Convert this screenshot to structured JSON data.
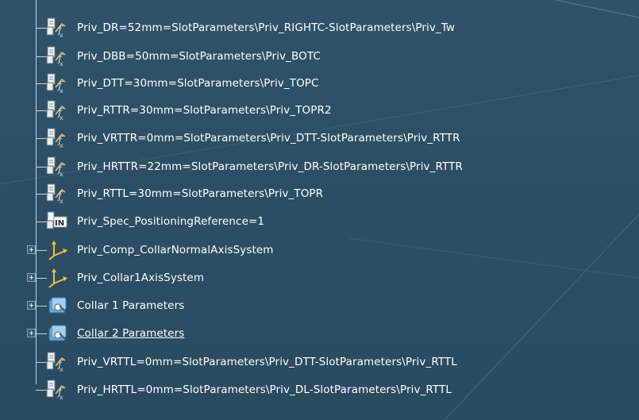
{
  "tree": {
    "items": [
      {
        "label": "Priv_DR=52mm=SlotParameters\\Priv_RIGHTC-SlotParameters\\Priv_Tw",
        "icon": "formula-icon",
        "expandable": false
      },
      {
        "label": "Priv_DBB=50mm=SlotParameters\\Priv_BOTC",
        "icon": "formula-icon",
        "expandable": false
      },
      {
        "label": "Priv_DTT=30mm=SlotParameters\\Priv_TOPC",
        "icon": "formula-icon",
        "expandable": false
      },
      {
        "label": "Priv_RTTR=30mm=SlotParameters\\Priv_TOPR2",
        "icon": "formula-icon",
        "expandable": false
      },
      {
        "label": "Priv_VRTTR=0mm=SlotParameters\\Priv_DTT-SlotParameters\\Priv_RTTR",
        "icon": "formula-icon",
        "expandable": false
      },
      {
        "label": "Priv_HRTTR=22mm=SlotParameters\\Priv_DR-SlotParameters\\Priv_RTTR",
        "icon": "formula-icon",
        "expandable": false
      },
      {
        "label": "Priv_RTTL=30mm=SlotParameters\\Priv_TOPR",
        "icon": "formula-icon",
        "expandable": false
      },
      {
        "label": "Priv_Spec_PositioningReference=1",
        "icon": "integer-parameter-icon",
        "expandable": false
      },
      {
        "label": "Priv_Comp_CollarNormalAxisSystem",
        "icon": "axis-system-icon",
        "expandable": true
      },
      {
        "label": "Priv_Collar1AxisSystem",
        "icon": "axis-system-icon",
        "expandable": true
      },
      {
        "label": "Collar 1 Parameters",
        "icon": "parameter-set-icon",
        "expandable": true
      },
      {
        "label": "Collar 2 Parameters",
        "icon": "parameter-set-icon",
        "expandable": true,
        "underlined": true
      },
      {
        "label": "Priv_VRTTL=0mm=SlotParameters\\Priv_DTT-SlotParameters\\Priv_RTTL",
        "icon": "formula-icon",
        "expandable": false
      },
      {
        "label": "Priv_HRTTL=0mm=SlotParameters\\Priv_DL-SlotParameters\\Priv_RTTL",
        "icon": "formula-icon",
        "expandable": false
      }
    ]
  },
  "colors": {
    "background": "#2c4e64",
    "text": "#ffffff",
    "tree_line": "#c7d3da"
  }
}
